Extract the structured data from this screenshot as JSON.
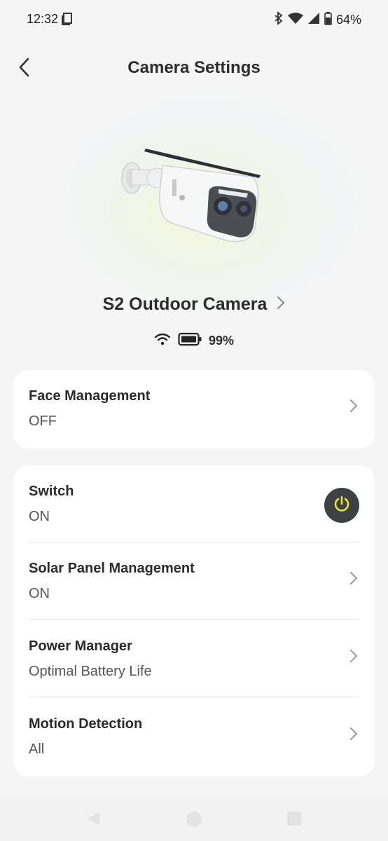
{
  "status_bar": {
    "time": "12:32",
    "battery_percent": "64%",
    "icons": [
      "screen-icon",
      "bluetooth-icon",
      "wifi-icon",
      "signal-icon",
      "battery-icon"
    ]
  },
  "header": {
    "title": "Camera Settings",
    "back_icon": "chevron-left-icon"
  },
  "device": {
    "name": "S2 Outdoor Camera",
    "battery": "99%",
    "image": "outdoor-camera-image"
  },
  "face_card": {
    "title": "Face Management",
    "value": "OFF"
  },
  "settings": [
    {
      "title": "Switch",
      "value": "ON",
      "control": "power-toggle"
    },
    {
      "title": "Solar Panel Management",
      "value": "ON",
      "control": "chevron"
    },
    {
      "title": "Power Manager",
      "value": "Optimal Battery Life",
      "control": "chevron"
    },
    {
      "title": "Motion Detection",
      "value": "All",
      "control": "chevron"
    }
  ],
  "colors": {
    "background": "#f5f5f5",
    "card": "#ffffff",
    "toggle_bg": "#3d4144",
    "toggle_icon": "#e6e23a"
  },
  "nav_bar": {
    "buttons": [
      "back-triangle-icon",
      "home-circle-icon",
      "recents-square-icon"
    ]
  }
}
